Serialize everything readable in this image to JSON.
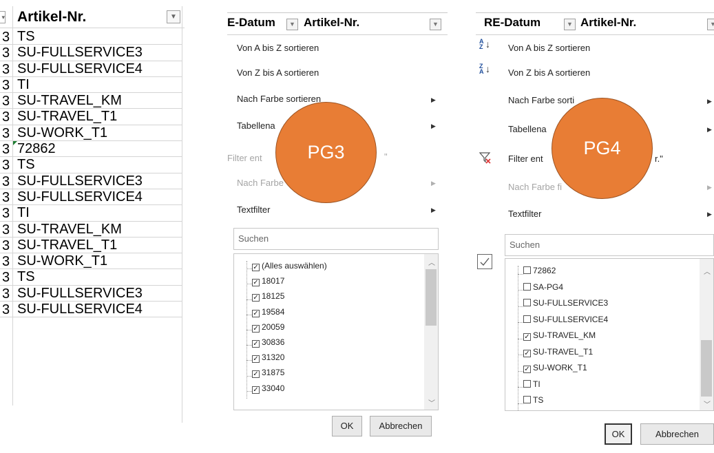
{
  "panel1": {
    "header": "Artikel-Nr.",
    "dropdown_icon": "chevron-down-icon",
    "row_prefix": "3",
    "rows": [
      "TS",
      "SU-FULLSERVICE3",
      "SU-FULLSERVICE4",
      "TI",
      "SU-TRAVEL_KM",
      "SU-TRAVEL_T1",
      "SU-WORK_T1",
      "72862",
      "TS",
      "SU-FULLSERVICE3",
      "SU-FULLSERVICE4",
      "TI",
      "SU-TRAVEL_KM",
      "SU-TRAVEL_T1",
      "SU-WORK_T1",
      "TS",
      "SU-FULLSERVICE3",
      "SU-FULLSERVICE4"
    ]
  },
  "panel2": {
    "col1_header": "E-Datum",
    "col2_header": "Artikel-Nr.",
    "menu": {
      "sort_az": "Von A bis Z sortieren",
      "sort_za": "Von Z bis A sortieren",
      "sort_color": "Nach Farbe sortieren",
      "table_view": "Tabellena",
      "clear_filter": "Filter ent",
      "clear_filter_tail": "\"",
      "filter_color": "Nach Farbe",
      "text_filter": "Textfilter"
    },
    "search_placeholder": "Suchen",
    "list": [
      "(Alles auswählen)",
      "18017",
      "18125",
      "19584",
      "20059",
      "30836",
      "31320",
      "31875",
      "33040"
    ],
    "ok": "OK",
    "cancel": "Abbrechen",
    "badge": "PG3",
    "badge_color": "#E87D35"
  },
  "panel3": {
    "col1_header": "RE-Datum",
    "col2_header": "Artikel-Nr.",
    "menu": {
      "sort_az": "Von A bis Z sortieren",
      "sort_za": "Von Z bis A sortieren",
      "sort_color": "Nach Farbe sorti",
      "table_view": "Tabellena",
      "clear_filter": "Filter ent",
      "clear_filter_tail": "r.\"",
      "filter_color": "Nach Farbe fi",
      "text_filter": "Textfilter"
    },
    "search_placeholder": "Suchen",
    "list": [
      "72862",
      "SA-PG4",
      "SU-FULLSERVICE3",
      "SU-FULLSERVICE4",
      "SU-TRAVEL_KM",
      "SU-TRAVEL_T1",
      "SU-WORK_T1",
      "TI",
      "TS"
    ],
    "list_checked": [
      false,
      false,
      false,
      false,
      true,
      true,
      true,
      false,
      false
    ],
    "ok": "OK",
    "cancel": "Abbrechen",
    "badge": "PG4",
    "badge_color": "#E87D35",
    "sort_az_icon": "sort-az-icon",
    "sort_za_icon": "sort-za-icon",
    "clear_filter_icon": "funnel-clear-icon"
  }
}
